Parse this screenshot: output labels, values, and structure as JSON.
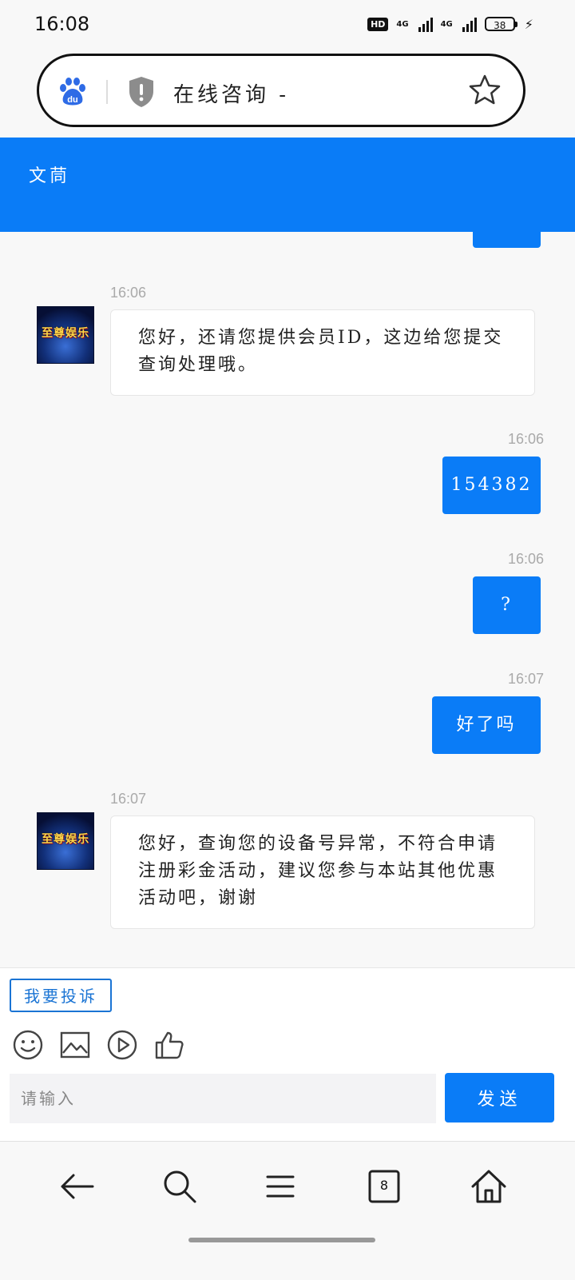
{
  "status_bar": {
    "time": "16:08",
    "hd_badge": "HD",
    "network1": "4G",
    "network2": "4G",
    "battery": "38"
  },
  "browser": {
    "title": "在线咨询 -"
  },
  "chat": {
    "header_title": "文茼",
    "messages": [
      {
        "sender": "agent",
        "time": "16:06",
        "text": "您好，还请您提供会员ID，这边给您提交查询处理哦。"
      },
      {
        "sender": "user",
        "time": "16:06",
        "text": "154382"
      },
      {
        "sender": "user",
        "time": "16:06",
        "text": "?"
      },
      {
        "sender": "user",
        "time": "16:07",
        "text": "好了吗"
      },
      {
        "sender": "agent",
        "time": "16:07",
        "text": "您好，查询您的设备号异常，不符合申请注册彩金活动，建议您参与本站其他优惠活动吧，谢谢"
      }
    ],
    "agent_avatar_text": "至尊娱乐"
  },
  "composer": {
    "complain_label": "我要投诉",
    "input_placeholder": "请输入",
    "send_label": "发送"
  },
  "nav": {
    "tabs_count": "8"
  },
  "colors": {
    "accent": "#0a7cf7",
    "link": "#1a74d4"
  }
}
